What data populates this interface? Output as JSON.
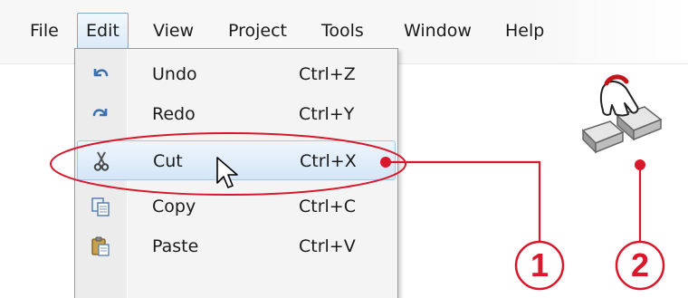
{
  "menubar": {
    "items": [
      {
        "label": "File"
      },
      {
        "label": "Edit"
      },
      {
        "label": "View"
      },
      {
        "label": "Project"
      },
      {
        "label": "Tools"
      },
      {
        "label": "Window"
      },
      {
        "label": "Help"
      }
    ]
  },
  "edit_menu": {
    "items": [
      {
        "label": "Undo",
        "shortcut": "Ctrl+Z",
        "icon": "undo-icon"
      },
      {
        "label": "Redo",
        "shortcut": "Ctrl+Y",
        "icon": "redo-icon"
      },
      {
        "label": "Cut",
        "shortcut": "Ctrl+X",
        "icon": "scissors-icon"
      },
      {
        "label": "Copy",
        "shortcut": "Ctrl+C",
        "icon": "copy-icon"
      },
      {
        "label": "Paste",
        "shortcut": "Ctrl+V",
        "icon": "paste-icon"
      }
    ],
    "highlighted_item": "Cut"
  },
  "annotations": {
    "callout_1": "1",
    "callout_2": "2",
    "accent_color": "#d9182b"
  }
}
